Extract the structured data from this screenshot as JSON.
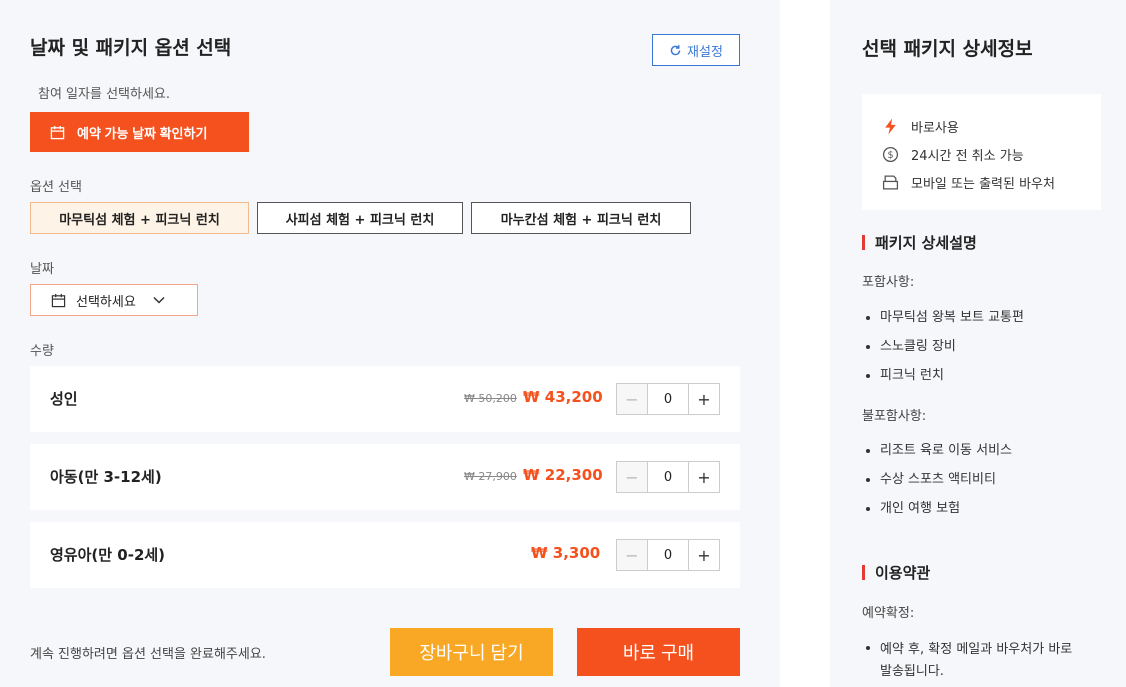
{
  "left": {
    "title": "날짜 및 패키지 옵션 선택",
    "reset_label": "재설정",
    "hint": "참여 일자를 선택하세요.",
    "date_check_label": "예약 가능 날짜 확인하기",
    "option_label": "옵션 선택",
    "options": [
      {
        "label": "마무틱섬 체험 + 피크닉 런치",
        "selected": true
      },
      {
        "label": "사피섬 체험 + 피크닉 런치",
        "selected": false
      },
      {
        "label": "마누칸섬 체험 + 피크닉 런치",
        "selected": false
      }
    ],
    "date_label": "날짜",
    "date_placeholder": "선택하세요",
    "qty_label": "수량",
    "rows": [
      {
        "name": "성인",
        "orig_price": "₩ 50,200",
        "price": "₩ 43,200",
        "qty": "0"
      },
      {
        "name": "아동(만 3-12세)",
        "orig_price": "₩ 27,900",
        "price": "₩ 22,300",
        "qty": "0"
      },
      {
        "name": "영유아(만 0-2세)",
        "orig_price": "",
        "price": "₩ 3,300",
        "qty": "0"
      }
    ],
    "minus_symbol": "−",
    "plus_symbol": "+",
    "footer_msg": "계속 진행하려면 옵션 선택을 완료해주세요.",
    "cart_label": "장바구니 담기",
    "buy_label": "바로 구매"
  },
  "right": {
    "title": "선택 패키지 상세정보",
    "features": [
      {
        "icon": "lightning-icon",
        "text": "바로사용"
      },
      {
        "icon": "refund-icon",
        "text": "24시간 전 취소 가능"
      },
      {
        "icon": "voucher-icon",
        "text": "모바일 또는 출력된 바우처"
      }
    ],
    "pkg_heading": "패키지 상세설명",
    "included_label": "포함사항:",
    "included": [
      "마무틱섬 왕복 보트 교통편",
      "스노클링 장비",
      "피크닉 런치"
    ],
    "excluded_label": "불포함사항:",
    "excluded": [
      "리조트 육로 이동 서비스",
      "수상 스포츠 액티비티",
      "개인 여행 보험"
    ],
    "terms_heading": "이용약관",
    "confirm_label": "예약확정:",
    "confirm_items": [
      "예약 후, 확정 메일과 바우처가 바로 발송됩니다."
    ]
  },
  "colors": {
    "accent": "#f4511e",
    "cart": "#f9a825",
    "link_blue": "#3a78d6",
    "section_bar": "#e53935"
  }
}
